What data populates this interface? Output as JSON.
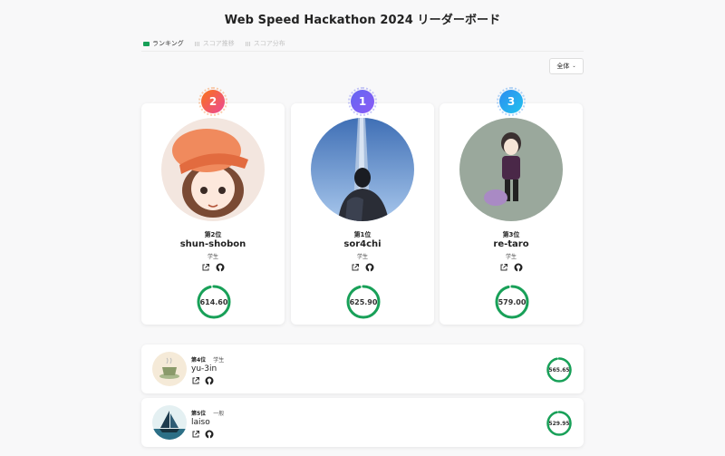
{
  "header": {
    "title": "Web Speed Hackathon 2024 リーダーボード"
  },
  "tabs": [
    {
      "label": "ランキング",
      "active": true,
      "icon": "trophy-icon"
    },
    {
      "label": "スコア推移",
      "active": false,
      "icon": "bar-chart-icon"
    },
    {
      "label": "スコア分布",
      "active": false,
      "icon": "bar-chart-icon"
    }
  ],
  "filter": {
    "label": "全体"
  },
  "podium": [
    {
      "rank_label": "第2位",
      "rank_number": "2",
      "name": "shun-shobon",
      "role": "学生",
      "score": "614.60",
      "score_value": 614.6,
      "medal_color": "#f97316"
    },
    {
      "rank_label": "第1位",
      "rank_number": "1",
      "name": "sor4chi",
      "role": "学生",
      "score": "625.90",
      "score_value": 625.9,
      "medal_color": "#6366f1"
    },
    {
      "rank_label": "第3位",
      "rank_number": "3",
      "name": "re-taro",
      "role": "学生",
      "score": "579.00",
      "score_value": 579.0,
      "medal_color": "#2d8cf0"
    }
  ],
  "list": [
    {
      "rank_label": "第4位",
      "role": "学生",
      "name": "yu-3in",
      "score": "565.65"
    },
    {
      "rank_label": "第5位",
      "role": "一般",
      "name": "laiso",
      "score": "529.95"
    }
  ],
  "colors": {
    "accent": "#18a058",
    "track": "#e6f4ea"
  }
}
